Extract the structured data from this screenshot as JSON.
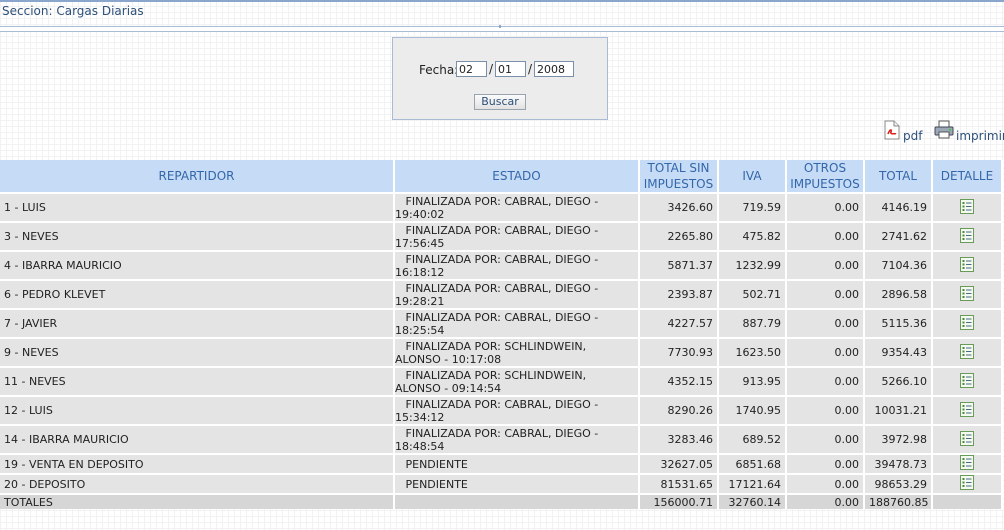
{
  "section": {
    "title": "Seccion: Cargas Diarias"
  },
  "filter": {
    "fecha_label": "Fecha:",
    "day": "02",
    "month": "01",
    "year": "2008",
    "separator": "/",
    "search_label": "Buscar"
  },
  "exports": {
    "pdf_label": "pdf",
    "print_label": "imprimir"
  },
  "table": {
    "headers": {
      "repartidor": "REPARTIDOR",
      "estado": "ESTADO",
      "total_sin_impuestos": "TOTAL SIN IMPUESTOS",
      "iva": "IVA",
      "otros_impuestos": "OTROS IMPUESTOS",
      "total": "TOTAL",
      "detalle": "DETALLE"
    },
    "rows": [
      {
        "repartidor": "1 - LUIS",
        "estado": "FINALIZADA POR: CABRAL, DIEGO - 19:40:02",
        "total_sin": "3426.60",
        "iva": "719.59",
        "otros": "0.00",
        "total": "4146.19"
      },
      {
        "repartidor": "3 - NEVES",
        "estado": "FINALIZADA POR: CABRAL, DIEGO - 17:56:45",
        "total_sin": "2265.80",
        "iva": "475.82",
        "otros": "0.00",
        "total": "2741.62"
      },
      {
        "repartidor": "4 - IBARRA MAURICIO",
        "estado": "FINALIZADA POR: CABRAL, DIEGO - 16:18:12",
        "total_sin": "5871.37",
        "iva": "1232.99",
        "otros": "0.00",
        "total": "7104.36"
      },
      {
        "repartidor": "6 - PEDRO KLEVET",
        "estado": "FINALIZADA POR: CABRAL, DIEGO - 19:28:21",
        "total_sin": "2393.87",
        "iva": "502.71",
        "otros": "0.00",
        "total": "2896.58"
      },
      {
        "repartidor": "7 - JAVIER",
        "estado": "FINALIZADA POR: CABRAL, DIEGO - 18:25:54",
        "total_sin": "4227.57",
        "iva": "887.79",
        "otros": "0.00",
        "total": "5115.36"
      },
      {
        "repartidor": "9 - NEVES",
        "estado": "FINALIZADA POR: SCHLINDWEIN, ALONSO - 10:17:08",
        "total_sin": "7730.93",
        "iva": "1623.50",
        "otros": "0.00",
        "total": "9354.43"
      },
      {
        "repartidor": "11 - NEVES",
        "estado": "FINALIZADA POR: SCHLINDWEIN, ALONSO - 09:14:54",
        "total_sin": "4352.15",
        "iva": "913.95",
        "otros": "0.00",
        "total": "5266.10"
      },
      {
        "repartidor": "12 - LUIS",
        "estado": "FINALIZADA POR: CABRAL, DIEGO - 15:34:12",
        "total_sin": "8290.26",
        "iva": "1740.95",
        "otros": "0.00",
        "total": "10031.21"
      },
      {
        "repartidor": "14 - IBARRA MAURICIO",
        "estado": "FINALIZADA POR: CABRAL, DIEGO - 18:48:54",
        "total_sin": "3283.46",
        "iva": "689.52",
        "otros": "0.00",
        "total": "3972.98"
      },
      {
        "repartidor": "19 - VENTA EN DEPOSITO",
        "estado": "PENDIENTE",
        "total_sin": "32627.05",
        "iva": "6851.68",
        "otros": "0.00",
        "total": "39478.73"
      },
      {
        "repartidor": "20 - DEPOSITO",
        "estado": "PENDIENTE",
        "total_sin": "81531.65",
        "iva": "17121.64",
        "otros": "0.00",
        "total": "98653.29"
      }
    ],
    "totals": {
      "label": "TOTALES",
      "total_sin": "156000.71",
      "iva": "32760.14",
      "otros": "0.00",
      "total": "188760.85"
    }
  },
  "icons": {
    "pdf": "pdf-icon",
    "print": "printer-icon",
    "detail": "detail-list-icon"
  },
  "colors": {
    "header_bg": "#c6dcf6",
    "header_text": "#3366aa",
    "row_bg": "#e4e4e4",
    "title_text": "#2d4f7a"
  }
}
